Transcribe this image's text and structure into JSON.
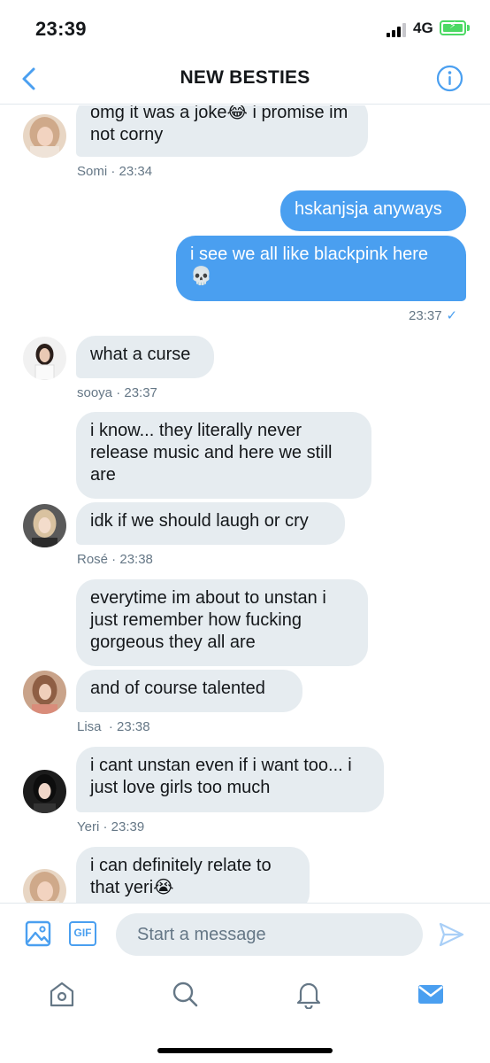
{
  "status_bar": {
    "time": "23:39",
    "network": "4G"
  },
  "header": {
    "title": "NEW BESTIES",
    "back_icon": "chevron-left-icon",
    "info_icon": "info-icon"
  },
  "messages": [
    {
      "sender": "Somi",
      "direction": "in",
      "text": "omg it was a joke😂 i promise im not corny"
    },
    {
      "meta": "Somi · 23:34"
    },
    {
      "direction": "out",
      "text": "hskanjsja anyways"
    },
    {
      "direction": "out",
      "text": "i see we all like blackpink here 💀"
    },
    {
      "meta": "23:37",
      "status": "✓"
    },
    {
      "sender": "sooya",
      "direction": "in",
      "text": "what a curse"
    },
    {
      "meta": "sooya · 23:37"
    },
    {
      "sender": "Rosé",
      "direction": "in",
      "text": "i know... they literally never release music and here we still are"
    },
    {
      "sender": "Rosé",
      "direction": "in",
      "text": "idk if we should laugh or cry"
    },
    {
      "meta": "Rosé · 23:38"
    },
    {
      "sender": "Lisa",
      "direction": "in",
      "text": "everytime im about to unstan i just remember how fucking gorgeous they all are"
    },
    {
      "sender": "Lisa",
      "direction": "in",
      "text": "and of course talented"
    },
    {
      "meta": "Lisa  · 23:38"
    },
    {
      "sender": "Yeri",
      "direction": "in",
      "text": "i cant unstan even if i want too... i just love girls too much"
    },
    {
      "meta": "Yeri · 23:39"
    },
    {
      "sender": "Somi",
      "direction": "in",
      "text": "i can definitely relate to that yeri😭"
    }
  ],
  "composer": {
    "placeholder": "Start a message",
    "gif_label": "GIF",
    "image_icon": "image-icon",
    "send_icon": "send-icon"
  },
  "tabbar": {
    "items": [
      "home-icon",
      "search-icon",
      "notifications-icon",
      "messages-icon"
    ]
  },
  "colors": {
    "accent": "#4a9ff0",
    "incoming_bubble": "#e6ecf0",
    "meta_text": "#657786"
  }
}
